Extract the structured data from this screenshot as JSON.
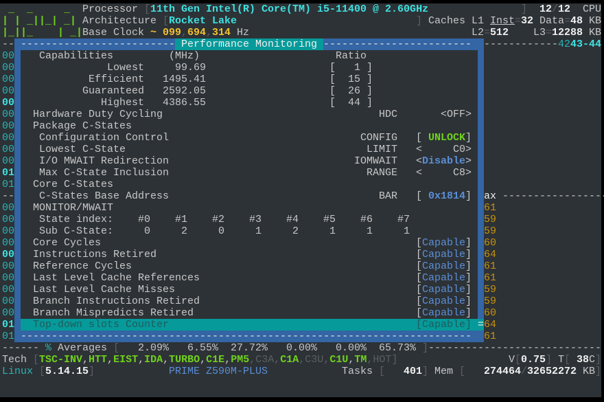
{
  "logo": {
    "lines": [
      " _  _     _ ",
      "| | _||_| _|",
      "|_||_    | _|"
    ]
  },
  "header": {
    "processor_label": "Processor",
    "processor_value": "11th Gen Intel(R) Core(TM) i5-11400 @ 2.60GHz",
    "cpu_online": "12",
    "cpu_total": "12",
    "cpu_label": "CPU",
    "architecture_label": "Architecture",
    "architecture_value": "Rocket Lake",
    "caches_label": "Caches",
    "l1_label": "L1",
    "inst_label": "Inst",
    "inst_value": "32",
    "data_label": "Data",
    "data_value": "48",
    "unit": "KB",
    "base_clock_label": "Base Clock",
    "base_clock_parts": [
      "099",
      "694",
      "314"
    ],
    "hz": "Hz",
    "l2_label": "L2",
    "l2_value": "512",
    "l3_label": "L3",
    "l3_value": "12288"
  },
  "left_column": [
    "--",
    "00",
    "00",
    "00",
    "00",
    "00",
    "00",
    "00",
    "00",
    "00",
    "00",
    "01",
    "01",
    "--",
    "00",
    "00",
    "00",
    "00",
    "00",
    "00",
    "00",
    "00",
    "00",
    "00",
    "01",
    "01"
  ],
  "right_column": {
    "header_dashes": "------------",
    "ids_dim": "42",
    "ids": "43-44",
    "ax": "ax",
    "ax_dashes": "------------------",
    "temps": [
      "61",
      "59",
      "59",
      "60",
      "64",
      "61",
      "61",
      "59",
      "59",
      "60",
      "64",
      "61"
    ]
  },
  "popup": {
    "title": "Performance Monitoring",
    "capabilities": {
      "label": "Capabilities",
      "unit": "(MHz)",
      "ratio_label": "Ratio",
      "rows": [
        {
          "label": "Lowest",
          "mhz": "99.69",
          "ratio": "1"
        },
        {
          "label": "Efficient",
          "mhz": "1495.41",
          "ratio": "15"
        },
        {
          "label": "Guaranteed",
          "mhz": "2592.05",
          "ratio": "26"
        },
        {
          "label": "Highest",
          "mhz": "4386.55",
          "ratio": "44"
        }
      ]
    },
    "hdc": {
      "label": "Hardware Duty Cycling",
      "key": "HDC",
      "value": "OFF"
    },
    "package_cstates": "Package C-States",
    "config": {
      "label": "Configuration Control",
      "key": "CONFIG",
      "value": "UNLOCK"
    },
    "limit": {
      "label": "Lowest C-State",
      "key": "LIMIT",
      "value": "C0"
    },
    "iomwait": {
      "label": "I/O MWAIT Redirection",
      "key": "IOMWAIT",
      "value": "Disable"
    },
    "range": {
      "label": "Max C-State Inclusion",
      "key": "RANGE",
      "value": "C8"
    },
    "core_cstates": "Core C-States",
    "bar": {
      "label": "C-States Base Address",
      "key": "BAR",
      "value": "0x1814"
    },
    "monitor": "MONITOR/MWAIT",
    "state_index_label": "State index:",
    "state_index": [
      "#0",
      "#1",
      "#2",
      "#3",
      "#4",
      "#5",
      "#6",
      "#7"
    ],
    "sub_cstate_label": "Sub C-State:",
    "sub_cstate": [
      "0",
      "2",
      "0",
      "1",
      "2",
      "1",
      "1",
      "1"
    ],
    "counters": [
      {
        "label": "Core Cycles",
        "value": "Capable"
      },
      {
        "label": "Instructions Retired",
        "value": "Capable"
      },
      {
        "label": "Reference Cycles",
        "value": "Capable"
      },
      {
        "label": "Last Level Cache References",
        "value": "Capable"
      },
      {
        "label": "Last Level Cache Misses",
        "value": "Capable"
      },
      {
        "label": "Branch Instructions Retired",
        "value": "Capable"
      },
      {
        "label": "Branch Mispredicts Retired",
        "value": "Capable"
      },
      {
        "label": "Top-down slots Counter",
        "value": "Capable"
      }
    ]
  },
  "footer": {
    "averages_label": "Averages",
    "averages": [
      "2.09%",
      "6.55%",
      "27.72%",
      "0.00%",
      "0.00%",
      "65.73%"
    ],
    "tech_label": "Tech",
    "tech": [
      {
        "t": "TSC-INV",
        "on": true
      },
      {
        "t": "HTT",
        "on": true
      },
      {
        "t": "EIST",
        "on": true
      },
      {
        "t": "IDA",
        "on": true
      },
      {
        "t": "TURBO",
        "on": true
      },
      {
        "t": "C1E",
        "on": true
      },
      {
        "t": "PM5",
        "on": true
      },
      {
        "t": "C3A",
        "on": false
      },
      {
        "t": "C1A",
        "on": true
      },
      {
        "t": "C3U",
        "on": false
      },
      {
        "t": "C1U",
        "on": true
      },
      {
        "t": "TM",
        "on": true
      },
      {
        "t": "HOT",
        "on": false
      }
    ],
    "voltage_label": "V",
    "voltage": "0.75",
    "temp_label": "T",
    "temp": "38",
    "temp_unit": "C",
    "os_label": "Linux",
    "kernel": "5.14.15",
    "board": "PRIME Z590M-PLUS",
    "tasks_label": "Tasks",
    "tasks": "401",
    "mem_label": "Mem",
    "mem_used": "274464",
    "mem_total": "32652272",
    "mem_unit": "KB"
  },
  "colors": {
    "background": "#2d3236",
    "frame": "#3465a4",
    "highlight": "#079a9a",
    "green": "#6fd21c",
    "teal": "#2ab3b3",
    "capable": "#5b8ed6",
    "temp": "#c8920c"
  }
}
